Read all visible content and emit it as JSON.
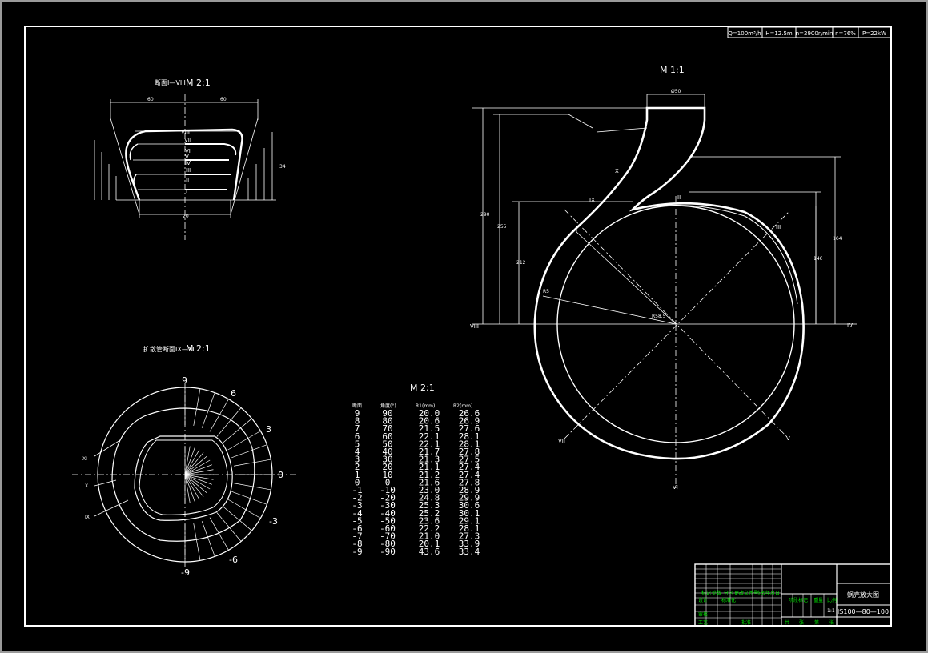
{
  "header_params": [
    "Q=100m³/h",
    "H=12.5m",
    "n=2900r/min",
    "η=76%",
    "P=22kW"
  ],
  "views": {
    "main_scale": "M 1:1",
    "section_I_VIII_title": "断面I—VIII",
    "section_I_VIII_scale": "M 2:1",
    "diffuser_title": "扩散管断面IX—XI",
    "diffuser_scale": "M 2:1",
    "table_scale": "M 2:1"
  },
  "main_view": {
    "section_marks": [
      "I",
      "II",
      "III",
      "IV",
      "V",
      "VI",
      "VII",
      "VIII",
      "IX",
      "X"
    ],
    "dims": {
      "throat": "R58.5",
      "outlet": "Ø50",
      "h1": "290",
      "h2": "255",
      "h3": "212",
      "h4": "164",
      "h5": "146",
      "tongue": "R5"
    }
  },
  "section_view": {
    "roman_labels": [
      "VIII",
      "VII",
      "VI",
      "V",
      "IV",
      "III",
      "II",
      "I"
    ],
    "dims": {
      "half_left": "60",
      "half_right": "60",
      "bottom": "20",
      "height": "34"
    }
  },
  "diffuser_view": {
    "angle_labels": [
      "9",
      "6",
      "3",
      "0",
      "-3",
      "-6",
      "-9"
    ],
    "section_labels": [
      "XI",
      "X",
      "IX"
    ]
  },
  "table": {
    "headers": [
      "断面",
      "角度(°)",
      "R1(mm)",
      "R2(mm)"
    ],
    "rows": [
      [
        "9",
        "90",
        "20.0",
        "26.6"
      ],
      [
        "8",
        "80",
        "20.6",
        "26.9"
      ],
      [
        "7",
        "70",
        "21.5",
        "27.6"
      ],
      [
        "6",
        "60",
        "22.1",
        "28.1"
      ],
      [
        "5",
        "50",
        "22.1",
        "28.1"
      ],
      [
        "4",
        "40",
        "21.7",
        "27.8"
      ],
      [
        "3",
        "30",
        "21.3",
        "27.5"
      ],
      [
        "2",
        "20",
        "21.1",
        "27.4"
      ],
      [
        "1",
        "10",
        "21.2",
        "27.4"
      ],
      [
        "0",
        "0",
        "21.6",
        "27.8"
      ],
      [
        "-1",
        "-10",
        "23.0",
        "28.9"
      ],
      [
        "-2",
        "-20",
        "24.8",
        "29.9"
      ],
      [
        "-3",
        "-30",
        "25.3",
        "30.6"
      ],
      [
        "-4",
        "-40",
        "25.2",
        "30.1"
      ],
      [
        "-5",
        "-50",
        "23.6",
        "29.1"
      ],
      [
        "-6",
        "-60",
        "22.2",
        "28.1"
      ],
      [
        "-7",
        "-70",
        "21.0",
        "27.3"
      ],
      [
        "-8",
        "-80",
        "20.1",
        "33.9"
      ],
      [
        "-9",
        "-90",
        "43.6",
        "33.4"
      ]
    ]
  },
  "title_block": {
    "drawing_name": "蜗壳放大图",
    "drawing_number": "IS100—80—100",
    "labels": [
      "标记",
      "处数",
      "分区",
      "更改文件号",
      "签名",
      "年月日",
      "设计",
      "标准化",
      "阶段标记",
      "重量",
      "比例",
      "审核",
      "工艺",
      "批准",
      "共",
      "张",
      "第",
      "张"
    ],
    "ratio": "1:1"
  },
  "colors": {
    "background": "#000000",
    "lines": "#ffffff",
    "title_text": "#00e000",
    "frame": "#9a9a9a"
  }
}
